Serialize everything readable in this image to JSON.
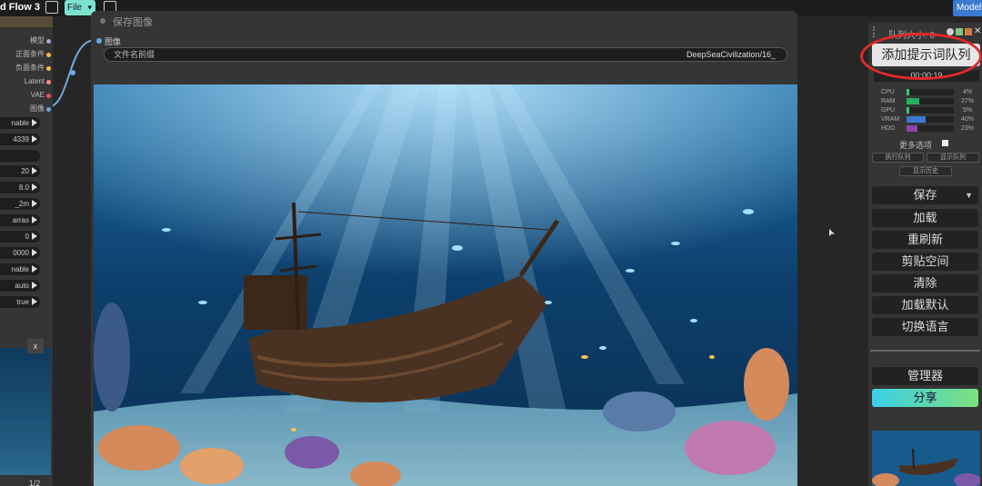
{
  "app": {
    "title": "d Flow 3",
    "file_menu_label": "File",
    "model_button_label": "Model"
  },
  "left_node": {
    "outputs": [
      {
        "label": "模型",
        "color": "#b39ddb"
      },
      {
        "label": "正面条件",
        "color": "#ffb74d"
      },
      {
        "label": "负面条件",
        "color": "#ffb74d"
      },
      {
        "label": "Latent",
        "color": "#ff8a80"
      },
      {
        "label": "VAE",
        "color": "#ef5350"
      },
      {
        "label": "图像",
        "color": "#6fa8dc"
      }
    ],
    "widgets": [
      "nable",
      "4339",
      "",
      "20",
      "8.0",
      "_2m",
      "arras",
      "0",
      "0000",
      "nable",
      "auto",
      "true"
    ],
    "close_label": "x",
    "page_indicator": "1/2"
  },
  "save_node": {
    "title": "保存图像",
    "input_label": "图像",
    "prefix_label": "文件名前缀",
    "prefix_value": "DeepSeaCivilization/16_"
  },
  "queue_panel": {
    "queue_size_label": "队列大小: 0",
    "add_prompt_label": "添加提示词队列",
    "timer": "00:00:19",
    "stats": [
      {
        "name": "CPU",
        "value": 4,
        "color": "#2ecc71"
      },
      {
        "name": "RAM",
        "value": 27,
        "color": "#27ae60"
      },
      {
        "name": "GPU",
        "value": 5,
        "color": "#2ecc71"
      },
      {
        "name": "VRAM",
        "value": 40,
        "color": "#3a7ad1"
      },
      {
        "name": "HDD",
        "value": 23,
        "color": "#8e44ad"
      }
    ],
    "extra_options_label": "更多选项",
    "view_queue_label": "执行队列",
    "view_history_label": "显示队列",
    "show_history_label": "显示历史",
    "buttons": {
      "save": "保存",
      "load": "加载",
      "refresh": "重刷新",
      "clipspace": "剪贴空间",
      "clear": "清除",
      "load_default": "加载默认",
      "switch_language": "切换语言",
      "manager": "管理器",
      "share": "分享"
    }
  }
}
